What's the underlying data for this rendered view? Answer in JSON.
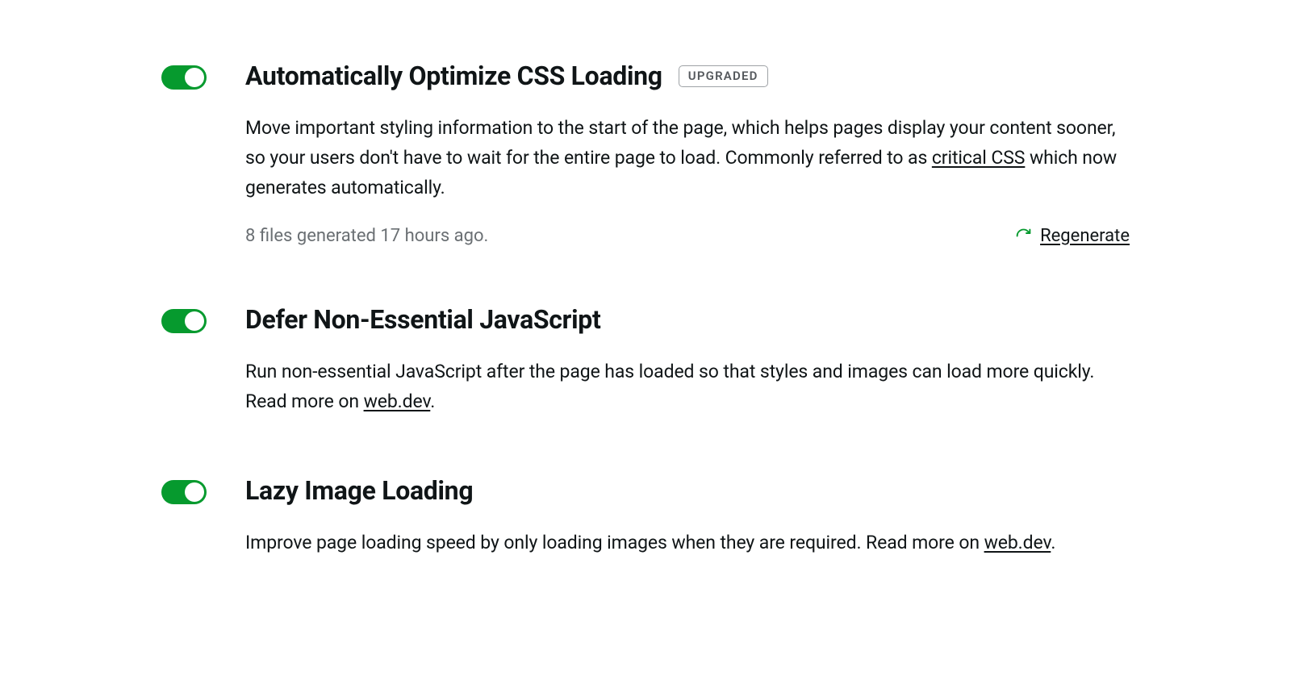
{
  "settings": [
    {
      "toggle_on": true,
      "title": "Automatically Optimize CSS Loading",
      "badge": "UPGRADED",
      "desc_pre": "Move important styling information to the start of the page, which helps pages display your content sooner, so your users don't have to wait for the entire page to load. Commonly referred to as ",
      "desc_link": "critical CSS",
      "desc_post": " which now generates automatically.",
      "status": "8 files generated 17 hours ago.",
      "action": "Regenerate"
    },
    {
      "toggle_on": true,
      "title": "Defer Non-Essential JavaScript",
      "desc_pre": "Run non-essential JavaScript after the page has loaded so that styles and images can load more quickly. Read more on ",
      "desc_link": "web.dev",
      "desc_post": "."
    },
    {
      "toggle_on": true,
      "title": "Lazy Image Loading",
      "desc_pre": "Improve page loading speed by only loading images when they are required. Read more on ",
      "desc_link": "web.dev",
      "desc_post": "."
    }
  ]
}
